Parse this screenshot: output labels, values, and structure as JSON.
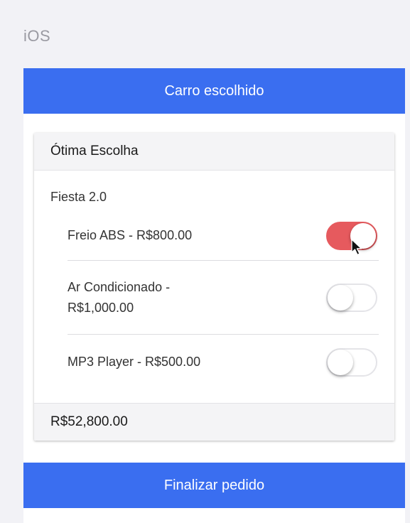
{
  "platform_label": "iOS",
  "navbar": {
    "title": "Carro escolhido"
  },
  "card": {
    "header": "Ótima Escolha",
    "car_name": "Fiesta 2.0",
    "options": [
      {
        "label": "Freio ABS - R$800.00",
        "enabled": true
      },
      {
        "label": "Ar Condicionado - R$1,000.00",
        "enabled": false
      },
      {
        "label": "MP3 Player - R$500.00",
        "enabled": false
      }
    ],
    "total": "R$52,800.00"
  },
  "finish_button": {
    "label": "Finalizar pedido"
  },
  "colors": {
    "accent": "#3a6ef0",
    "toggle_on": "#e65a5e"
  }
}
